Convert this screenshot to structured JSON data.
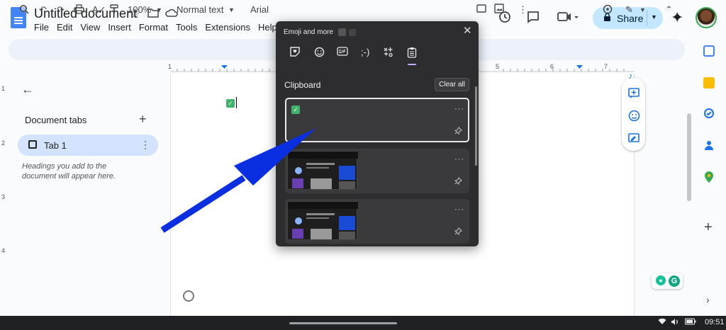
{
  "header": {
    "doc_title": "Untitled document",
    "menu": [
      "File",
      "Edit",
      "View",
      "Insert",
      "Format",
      "Tools",
      "Extensions",
      "Help"
    ],
    "share_label": "Share"
  },
  "toolbar": {
    "zoom": "100%",
    "style": "Normal text",
    "font": "Arial"
  },
  "ruler": {
    "numbers": [
      "1",
      "5",
      "6",
      "7"
    ]
  },
  "vruler": {
    "numbers": [
      "1",
      "2",
      "3",
      "4"
    ]
  },
  "doc_tabs": {
    "title": "Document tabs",
    "tab_label": "Tab 1",
    "hint": "Headings you add to the document will appear here."
  },
  "emoji_panel": {
    "title": "Emoji and more",
    "section_label": "Clipboard",
    "clear_label": "Clear all",
    "more_glyph": "···"
  },
  "taskbar": {
    "time": "09:51"
  },
  "colors": {
    "accent": "#1a73e8",
    "share_bg": "#c2e7ff",
    "arrow": "#0a2fe0",
    "popup_bg": "#2d2d2f"
  }
}
